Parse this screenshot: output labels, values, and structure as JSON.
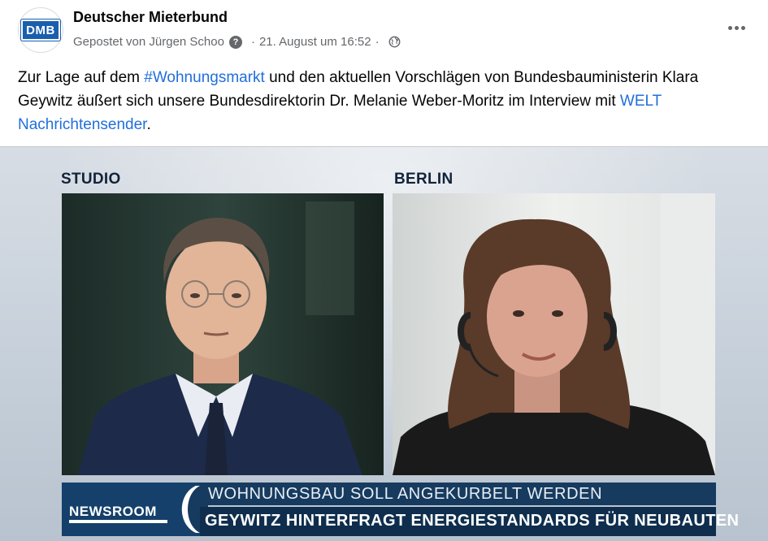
{
  "post": {
    "page_name": "Deutscher Mieterbund",
    "avatar_text": "DMB",
    "posted_by": "Gepostet von Jürgen Schoo",
    "info_icon": "?",
    "separator": "·",
    "timestamp": "21. August um 16:52",
    "globe_icon": "globe-icon",
    "more_icon": "more-options-icon",
    "text": {
      "part1": "Zur Lage auf dem ",
      "hashtag": "#Wohnungsmarkt",
      "part2": " und den aktuellen Vorschlägen von Bundesbauministerin Klara Geywitz äußert sich unsere Bundesdirektorin Dr. Melanie Weber-Moritz im Interview mit ",
      "link": "WELT Nachrichtensender",
      "part3": "."
    }
  },
  "video": {
    "label_left": "STUDIO",
    "label_right": "BERLIN",
    "ticker": {
      "brand": "NEWSROOM",
      "headline_top": "WOHNUNGSBAU SOLL ANGEKURBELT WERDEN",
      "headline_bottom": "GEYWITZ HINTERFRAGT ENERGIESTANDARDS FÜR NEUBAUTEN"
    }
  },
  "colors": {
    "link": "#216fdb",
    "meta": "#65676b",
    "ticker_dark": "#0f2e4d",
    "ticker_top": "#173b5f"
  }
}
